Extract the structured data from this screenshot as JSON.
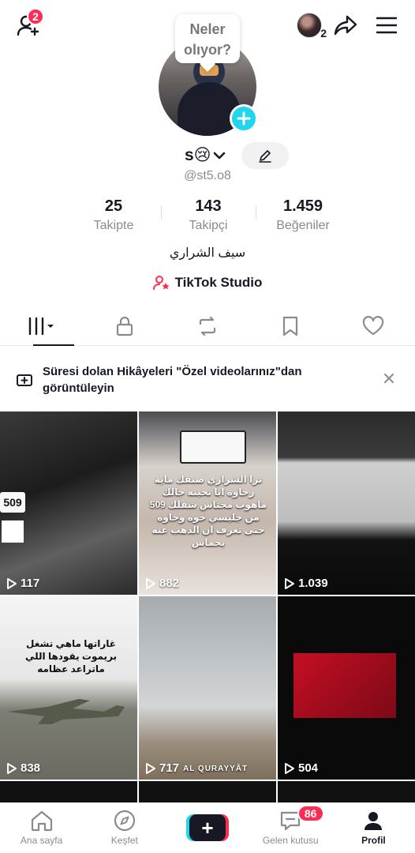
{
  "topbar": {
    "notification_count": "2",
    "linked_accounts_count": "2"
  },
  "profile": {
    "bubble_text": "Neler olıyor?",
    "display_name": "s😢",
    "username": "@st5.o8",
    "bio": "سيف الشراري",
    "studio_label": "TikTok Studio"
  },
  "stats": [
    {
      "value": "25",
      "label": "Takipte"
    },
    {
      "value": "143",
      "label": "Takipçi"
    },
    {
      "value": "1.459",
      "label": "Beğeniler"
    }
  ],
  "banner": {
    "text": "Süresi dolan Hikâyeleri \"Özel videolarınız\"dan görüntüleyin"
  },
  "videos": [
    {
      "plays": "117",
      "overlay": "509"
    },
    {
      "plays": "882",
      "overlay": "تزا الشراري صنقك ماية رخاوة ابا تحبنه جالك ماهوب محتاس شقلك 509 من جليسي خوه وخاوه حتى تعرف ان الذهب عنه بخماس"
    },
    {
      "plays": "1.039",
      "overlay": ""
    },
    {
      "plays": "838",
      "overlay": "غاراتها ماهي تشغل بريموت يقودها اللي ماتراعد عظامه"
    },
    {
      "plays": "717",
      "overlay": "AL QURAYYĀT"
    },
    {
      "plays": "504",
      "overlay": ""
    }
  ],
  "nav": {
    "home": "Ana sayfa",
    "discover": "Keşfet",
    "inbox": "Gelen kutusu",
    "inbox_badge": "86",
    "profile": "Profil"
  },
  "colors": {
    "accent_red": "#fe2c55",
    "accent_cyan": "#20d5ec",
    "text_primary": "#161823",
    "text_secondary": "#8a8b91"
  }
}
